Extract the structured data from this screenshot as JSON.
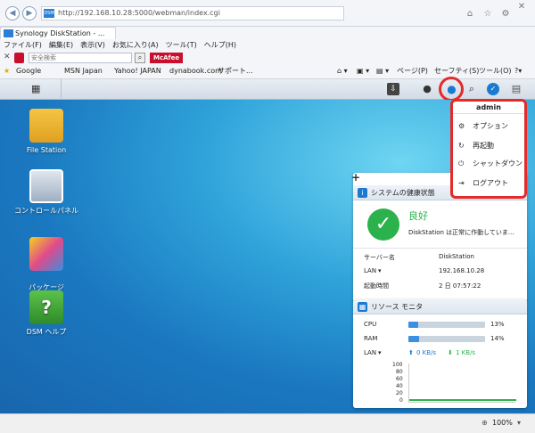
{
  "browser": {
    "url": "http://192.168.10.28:5000/webman/index.cgi",
    "tab_title": "Synology DiskStation - ...",
    "menu": [
      "ファイル(F)",
      "編集(E)",
      "表示(V)",
      "お気に入り(A)",
      "ツール(T)",
      "ヘルプ(H)"
    ],
    "search_placeholder": "安全検索",
    "mcafee_label": "McAfee",
    "favorites": [
      "Google",
      "MSN Japan",
      "Yahoo! JAPAN",
      "dynabook.com",
      "サポート..."
    ],
    "command_bar": [
      "ページ(P)",
      "セーフティ(S)",
      "ツール(O)"
    ],
    "zoom": "100%"
  },
  "desktop_icons": [
    {
      "label": "File Station"
    },
    {
      "label": "コントロールパネル"
    },
    {
      "label": "パッケージ\nセンター"
    },
    {
      "label": "DSM ヘルプ"
    }
  ],
  "user_menu": {
    "username": "admin",
    "items": [
      {
        "label": "オプション",
        "icon": "gear-icon"
      },
      {
        "label": "再起動",
        "icon": "restart-icon"
      },
      {
        "label": "シャットダウン",
        "icon": "power-icon"
      },
      {
        "label": "ログアウト",
        "icon": "logout-icon"
      }
    ]
  },
  "health_widget": {
    "title": "システムの健康状態",
    "status": "良好",
    "message": "DiskStation は正常に作動していま...",
    "rows": [
      {
        "key": "サーバー名",
        "value": "DiskStation"
      },
      {
        "key": "LAN",
        "value": "192.168.10.28"
      },
      {
        "key": "起動時間",
        "value": "2 日 07:57:22"
      }
    ]
  },
  "resource_widget": {
    "title": "リソース モニタ",
    "cpu_label": "CPU",
    "cpu_value": "13%",
    "cpu_pct": 13,
    "ram_label": "RAM",
    "ram_value": "14%",
    "ram_pct": 14,
    "lan_label": "LAN",
    "upload": "0 KB/s",
    "download": "1 KB/s",
    "y_ticks": [
      "100",
      "80",
      "60",
      "40",
      "20",
      "0"
    ]
  },
  "add_widget_symbol": "+",
  "colors": {
    "highlight": "#e52a2a",
    "accent": "#1a7ad2",
    "good": "#2bb24c"
  }
}
